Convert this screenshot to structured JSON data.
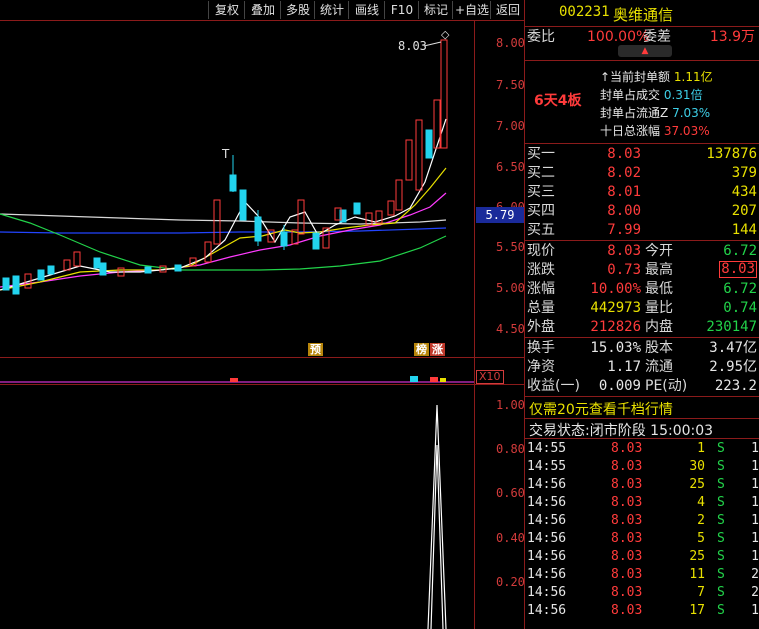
{
  "toolbar": {
    "buttons": [
      "复权",
      "叠加",
      "多股",
      "统计",
      "画线",
      "F10",
      "标记",
      "+自选",
      "返回"
    ]
  },
  "chart": {
    "price_labels": [
      "8.00",
      "7.50",
      "7.00",
      "6.50",
      "6.00",
      "5.50",
      "5.00",
      "4.50"
    ],
    "current_price_box": "5.79",
    "high_marker": "8.03",
    "tag_yu": "预",
    "tag_bang": "榜",
    "tag_zhang": "涨",
    "volume_mult": "X10",
    "indicator_labels": [
      "1.00",
      "0.80",
      "0.60",
      "0.40",
      "0.20"
    ]
  },
  "stock": {
    "code": "002231",
    "name": "奥维通信"
  },
  "order": {
    "weibi_label": "委比",
    "weibi_value": "100.00%",
    "weicha_label": "委差",
    "weicha_value": "13.9万"
  },
  "limit_up": {
    "badge": "6天4板",
    "lines": [
      {
        "label": "↑当前封单额",
        "value": "1.11亿"
      },
      {
        "label": "封单占成交",
        "value": "0.31倍"
      },
      {
        "label": "封单占流通Z",
        "value": "7.03%"
      },
      {
        "label": "十日总涨幅",
        "value": "37.03%"
      }
    ]
  },
  "bids": [
    {
      "label": "买一",
      "price": "8.03",
      "volume": "137876"
    },
    {
      "label": "买二",
      "price": "8.02",
      "volume": "379"
    },
    {
      "label": "买三",
      "price": "8.01",
      "volume": "434"
    },
    {
      "label": "买四",
      "price": "8.00",
      "volume": "207"
    },
    {
      "label": "买五",
      "price": "7.99",
      "volume": "144"
    }
  ],
  "quote": {
    "rows": [
      {
        "l1": "现价",
        "v1": "8.03",
        "l2": "今开",
        "v2": "6.72"
      },
      {
        "l1": "涨跌",
        "v1": "0.73",
        "l2": "最高",
        "v2": "8.03"
      },
      {
        "l1": "涨幅",
        "v1": "10.00%",
        "l2": "最低",
        "v2": "6.72"
      },
      {
        "l1": "总量",
        "v1": "442973",
        "l2": "量比",
        "v2": "0.74"
      },
      {
        "l1": "外盘",
        "v1": "212826",
        "l2": "内盘",
        "v2": "230147"
      }
    ]
  },
  "fundamentals": {
    "rows": [
      {
        "l1": "换手",
        "v1": "15.03%",
        "l2": "股本",
        "v2": "3.47亿"
      },
      {
        "l1": "净资",
        "v1": "1.17",
        "l2": "流通",
        "v2": "2.95亿"
      },
      {
        "l1": "收益(一)",
        "v1": "0.009",
        "l2": "PE(动)",
        "v2": "223.2"
      }
    ]
  },
  "promo": "仅需20元查看千档行情",
  "status": {
    "label": "交易状态:",
    "value": "闭市阶段 15:00:03"
  },
  "trades": [
    {
      "time": "14:55",
      "price": "8.03",
      "vol": "1",
      "side": "S",
      "n": "1"
    },
    {
      "time": "14:55",
      "price": "8.03",
      "vol": "30",
      "side": "S",
      "n": "1"
    },
    {
      "time": "14:56",
      "price": "8.03",
      "vol": "25",
      "side": "S",
      "n": "1"
    },
    {
      "time": "14:56",
      "price": "8.03",
      "vol": "4",
      "side": "S",
      "n": "1"
    },
    {
      "time": "14:56",
      "price": "8.03",
      "vol": "2",
      "side": "S",
      "n": "1"
    },
    {
      "time": "14:56",
      "price": "8.03",
      "vol": "5",
      "side": "S",
      "n": "1"
    },
    {
      "time": "14:56",
      "price": "8.03",
      "vol": "25",
      "side": "S",
      "n": "1"
    },
    {
      "time": "14:56",
      "price": "8.03",
      "vol": "11",
      "side": "S",
      "n": "2"
    },
    {
      "time": "14:56",
      "price": "8.03",
      "vol": "7",
      "side": "S",
      "n": "2"
    },
    {
      "time": "14:56",
      "price": "8.03",
      "vol": "17",
      "side": "S",
      "n": "1"
    }
  ],
  "colors": {
    "up": "#ff3b3b",
    "down": "#22d3ee",
    "frame": "#8b1b1b",
    "ma5": "#ffffff",
    "ma10": "#e8e000",
    "ma20": "#ff3bff",
    "ma60": "#22d34a",
    "ma120": "#2244ff"
  }
}
